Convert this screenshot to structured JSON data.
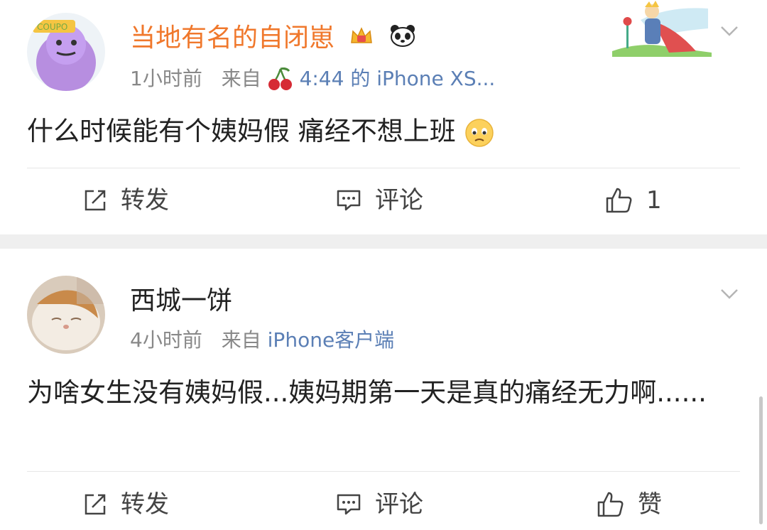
{
  "posts": [
    {
      "username": "当地有名的自闭崽",
      "time": "1小时前",
      "from_label": "来自",
      "source": "4:44 的 iPhone XS...",
      "text": "什么时候能有个姨妈假 痛经不想上班",
      "actions": {
        "repost": "转发",
        "comment": "评论",
        "like": "1"
      },
      "avatar_icon": "purple-cartoon-avatar",
      "badges": [
        "crown-icon",
        "panda-icon"
      ],
      "name_color": "#f0782c"
    },
    {
      "username": "西城一饼",
      "time": "4小时前",
      "from_label": "来自",
      "source": "iPhone客户端",
      "text": "为啥女生没有姨妈假...姨妈期第一天是真的痛经无力啊......",
      "actions": {
        "repost": "转发",
        "comment": "评论",
        "like": "赞"
      },
      "avatar_icon": "cat-avatar",
      "name_color": "#222222"
    }
  ],
  "colors": {
    "link": "#5b7fb5",
    "meta": "#888888",
    "separator": "#efefef"
  }
}
